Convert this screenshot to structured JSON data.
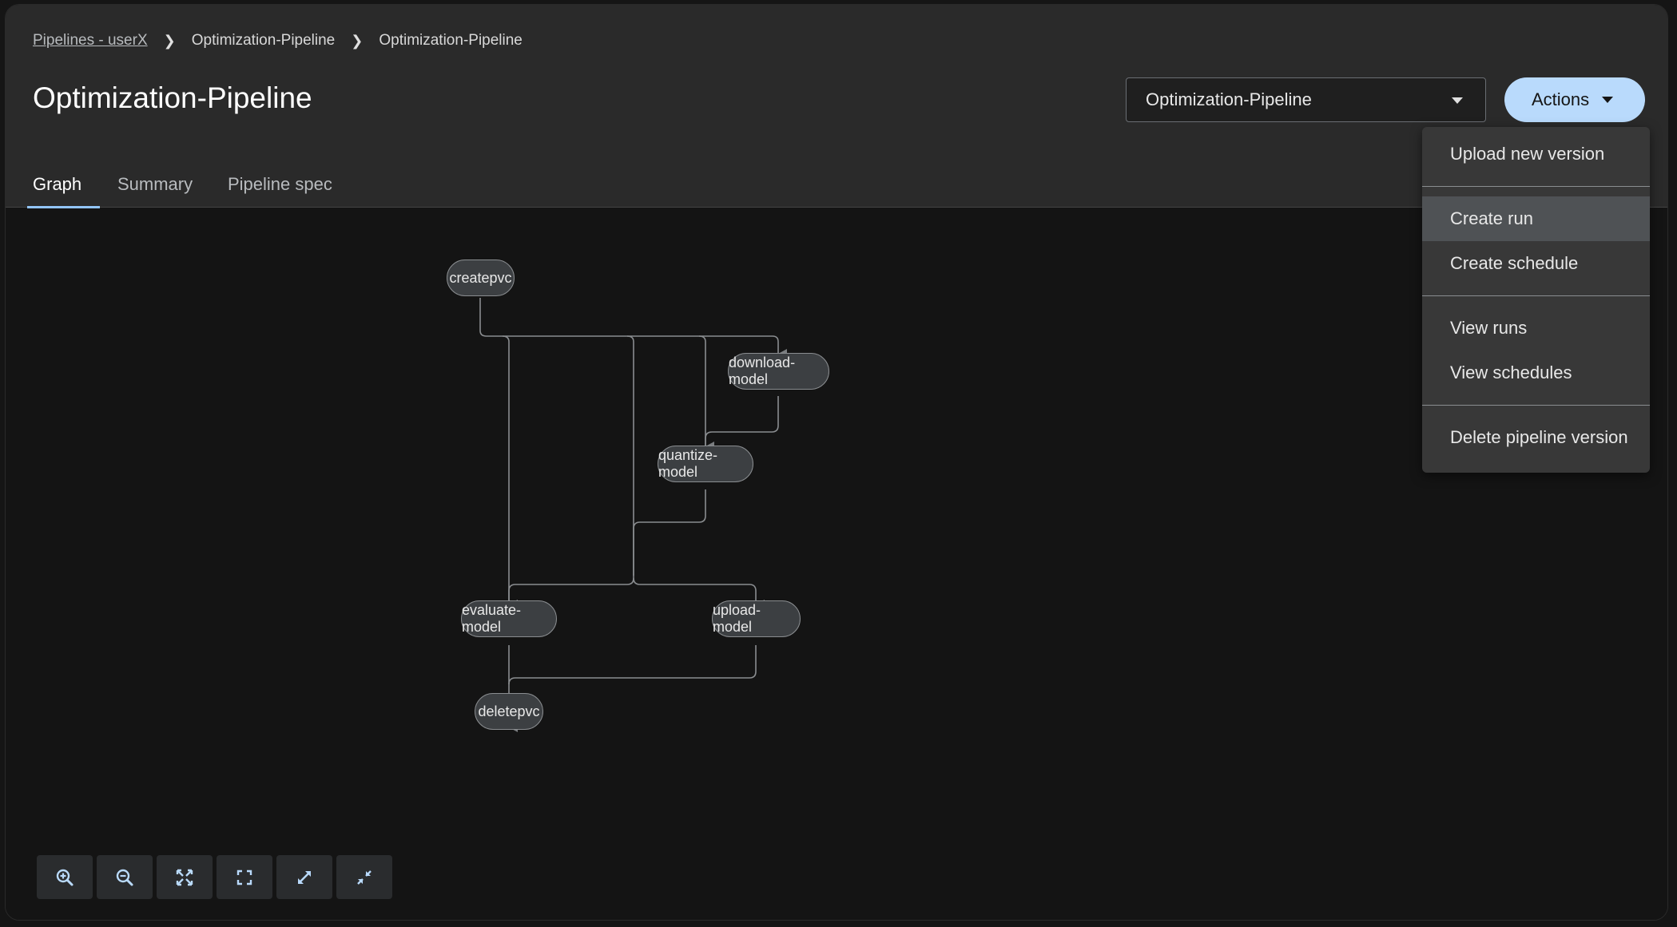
{
  "breadcrumb": {
    "root_link": "Pipelines - userX",
    "item_2": "Optimization-Pipeline",
    "item_3": "Optimization-Pipeline"
  },
  "page": {
    "title": "Optimization-Pipeline"
  },
  "version_select": {
    "selected": "Optimization-Pipeline"
  },
  "actions": {
    "label": "Actions"
  },
  "tabs": [
    {
      "label": "Graph",
      "active": true
    },
    {
      "label": "Summary",
      "active": false
    },
    {
      "label": "Pipeline spec",
      "active": false
    }
  ],
  "actions_menu": {
    "upload_new_version": "Upload new version",
    "create_run": "Create run",
    "create_schedule": "Create schedule",
    "view_runs": "View runs",
    "view_schedules": "View schedules",
    "delete_pipeline_version": "Delete pipeline version"
  },
  "graph": {
    "nodes": {
      "createpvc": "createpvc",
      "download_model": "download-model",
      "quantize_model": "quantize-model",
      "evaluate_model": "evaluate-model",
      "upload_model": "upload-model",
      "deletepvc": "deletepvc"
    }
  },
  "controls": {
    "icons": [
      "zoom-in-icon",
      "zoom-out-icon",
      "fit-to-screen-icon",
      "reset-view-icon",
      "expand-icon",
      "collapse-icon"
    ]
  },
  "colors": {
    "primary_button": "#b9dafc",
    "active_tab_underline": "#92c5f9",
    "node_fill": "#3c3f42",
    "edge": "#8a8d90"
  }
}
